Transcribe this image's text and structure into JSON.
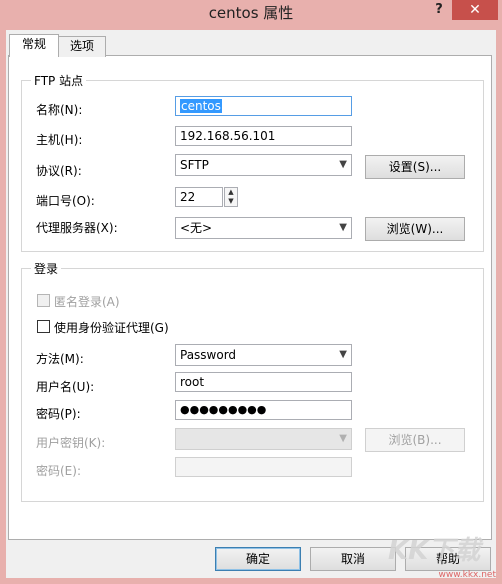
{
  "window": {
    "title": "centos 属性",
    "help": "?",
    "close": "✕"
  },
  "tabs": [
    {
      "label": "常规"
    },
    {
      "label": "选项"
    }
  ],
  "ftp_group": {
    "title": "FTP 站点",
    "name_label": "名称(N):",
    "name_value": "centos",
    "host_label": "主机(H):",
    "host_value": "192.168.56.101",
    "protocol_label": "协议(R):",
    "protocol_value": "SFTP",
    "settings_button": "设置(S)...",
    "port_label": "端口号(O):",
    "port_value": "22",
    "proxy_label": "代理服务器(X):",
    "proxy_value": "<无>",
    "browse_button": "浏览(W)..."
  },
  "login_group": {
    "title": "登录",
    "anonymous_label": "匿名登录(A)",
    "auth_agent_label": "使用身份验证代理(G)",
    "method_label": "方法(M):",
    "method_value": "Password",
    "username_label": "用户名(U):",
    "username_value": "root",
    "password_label": "密码(P):",
    "password_value": "●●●●●●●●●",
    "userkey_label": "用户密钥(K):",
    "userkey_value": "",
    "userkey_browse": "浏览(B)...",
    "passphrase_label": "密码(E):",
    "passphrase_value": ""
  },
  "footer": {
    "ok": "确定",
    "cancel": "取消",
    "help": "帮助"
  },
  "watermark": {
    "logo": "KK下载",
    "url": "www.kkx.net"
  }
}
